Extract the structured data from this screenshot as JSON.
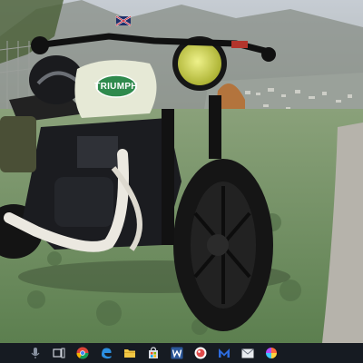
{
  "screen": {
    "type": "desktop",
    "wallpaper": "motorcycle-photo"
  },
  "wallpaper": {
    "subject": "cafe-racer-motorcycle",
    "tank_brand_text": "TRIUMPH",
    "colors": {
      "sky": "#c9cfd6",
      "mountain": "#8a8f86",
      "grass": "#6f8d63",
      "tank": "#e6e9d6",
      "logo_badge": "#2f8a4d",
      "headlight": "#d8df53",
      "tire": "#151515"
    }
  },
  "taskbar": {
    "background": "#161b22",
    "icons": [
      {
        "name": "microphone-icon",
        "color": "#8a93a2"
      },
      {
        "name": "task-view-icon",
        "color": "#d0d5dd"
      },
      {
        "name": "chrome-icon",
        "color": "#db4437"
      },
      {
        "name": "edge-icon",
        "color": "#2c8fe0"
      },
      {
        "name": "file-explorer-icon",
        "color": "#f2c744"
      },
      {
        "name": "store-icon",
        "color": "#d9dde4"
      },
      {
        "name": "word-icon",
        "color": "#2b579a"
      },
      {
        "name": "app-red-circle-icon",
        "color": "#e04b4b"
      },
      {
        "name": "app-m-icon",
        "color": "#2d6cdf"
      },
      {
        "name": "mail-icon",
        "color": "#e8ebef"
      },
      {
        "name": "app-multicolor-icon",
        "color": "#ff6a3d"
      }
    ]
  }
}
